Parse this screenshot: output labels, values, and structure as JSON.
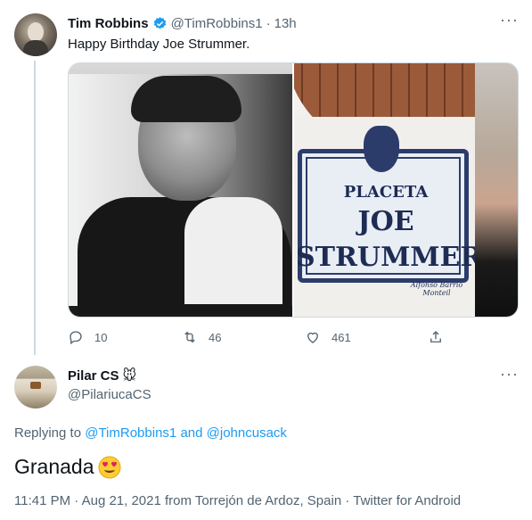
{
  "original_tweet": {
    "display_name": "Tim Robbins",
    "handle": "@TimRobbins1",
    "separator": "·",
    "time": "13h",
    "text": "Happy Birthday Joe Strummer.",
    "verified": true,
    "media": {
      "sign_text": [
        "PLACETA",
        "JOE",
        "STRUMMER",
        "Alfonso Barrio Monteil"
      ]
    },
    "actions": {
      "reply_count": "10",
      "retweet_count": "46",
      "like_count": "461"
    }
  },
  "reply_tweet": {
    "display_name": "Pilar CS",
    "name_emoji": "🐭",
    "handle": "@PilariucaCS",
    "replying_prefix": "Replying to",
    "replying_user_1": "@TimRobbins1",
    "replying_and": "and",
    "replying_user_2": "@johncusack",
    "text": "Granada",
    "text_emoji": "heart-eyes-emoji",
    "meta": "11:41 PM · Aug 21, 2021 from Torrejón de Ardoz, Spain · Twitter for Android"
  },
  "icons": {
    "more": "more-horizontal-icon",
    "verified": "verified-badge-icon",
    "reply": "reply-icon",
    "retweet": "retweet-icon",
    "like": "heart-icon",
    "share": "share-icon"
  },
  "colors": {
    "text_primary": "#0f1419",
    "text_secondary": "#536471",
    "accent": "#1d9bf0",
    "divider": "#cfd9de"
  }
}
